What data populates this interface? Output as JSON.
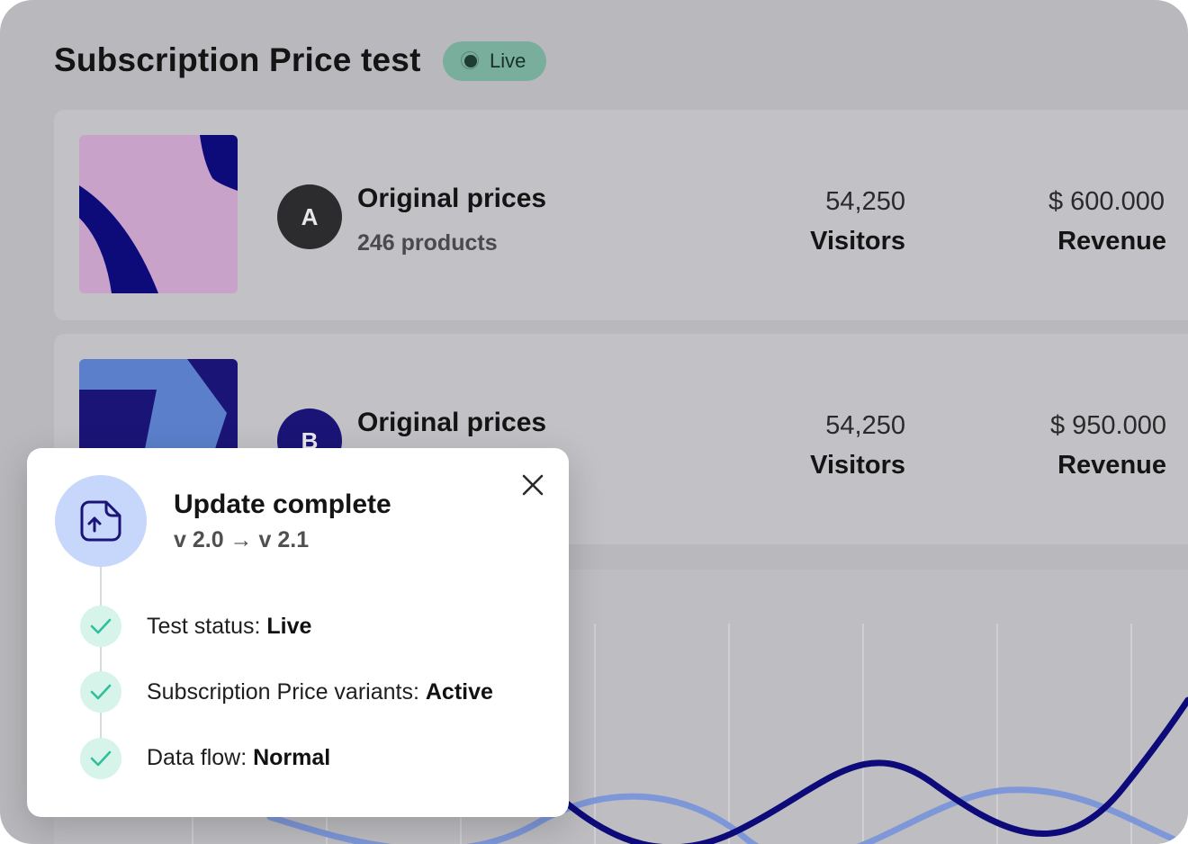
{
  "page": {
    "title": "Subscription Price test",
    "status_badge": "Live"
  },
  "variants": [
    {
      "letter": "A",
      "name": "Original prices",
      "products": "246 products",
      "visitors_value": "54,250",
      "visitors_label": "Visitors",
      "revenue_value": "$ 600.000",
      "revenue_label": "Revenue"
    },
    {
      "letter": "B",
      "name": "Original prices",
      "visitors_value": "54,250",
      "visitors_label": "Visitors",
      "revenue_value": "$ 950.000",
      "revenue_label": "Revenue"
    }
  ],
  "toast": {
    "title": "Update complete",
    "version": "v 2.0 → v 2.1",
    "icon": "file-upload-icon",
    "close_icon": "close-icon",
    "items": [
      {
        "label": "Test status: ",
        "value": "Live"
      },
      {
        "label": "Subscription Price variants: ",
        "value": "Active"
      },
      {
        "label": "Data flow: ",
        "value": "Normal"
      }
    ]
  },
  "colors": {
    "navy": "#0d0a7a",
    "light_series": "#7d97d8",
    "pink": "#c8a2c9",
    "blue": "#5b7fcb",
    "live_green": "#78ae9b",
    "check_bg": "#d6f4ea",
    "check_stroke": "#2fbf9a"
  }
}
